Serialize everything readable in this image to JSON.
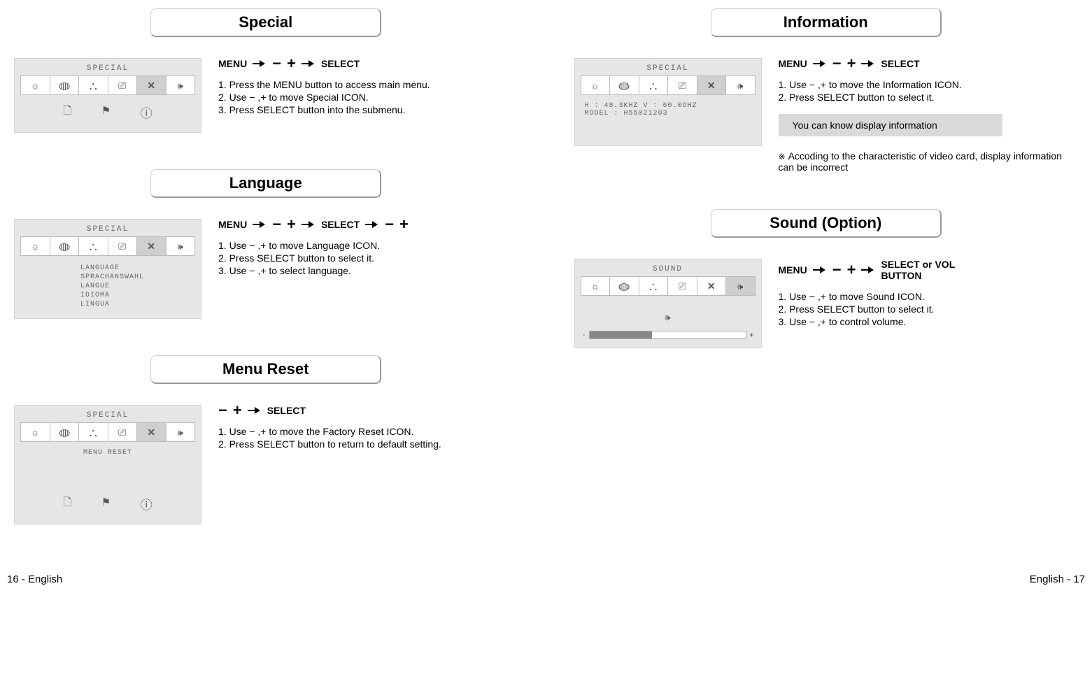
{
  "footer": {
    "left": "16 - English",
    "right": "English - 17"
  },
  "headings": {
    "special": "Special",
    "language": "Language",
    "menu_reset": "Menu Reset",
    "information": "Information",
    "sound": "Sound (Option)"
  },
  "buttons": {
    "menu": "MENU",
    "select": "SELECT",
    "select_or_vol": "SELECT or VOL BUTTON"
  },
  "osd": {
    "special_title": "SPECIAL",
    "sound_title": "SOUND",
    "lang_items": [
      "LANGUAGE",
      "SPRACHANSWAHL",
      "LANGUE",
      "IDIOMA",
      "LINGUA"
    ],
    "menu_reset_label": "MENU RESET",
    "info_line1": "H : 48.3KHZ  V : 60.0OHZ",
    "info_line2": "MODEL : H55021203"
  },
  "steps": {
    "special": [
      "1. Press the MENU button to access main menu.",
      "2. Use − ,+ to move Special ICON.",
      "3. Press SELECT button into the submenu."
    ],
    "language": [
      "1. Use − ,+ to move Language ICON.",
      "2. Press SELECT button to select it.",
      "3. Use − ,+ to select language."
    ],
    "menu_reset": [
      "1. Use − ,+ to move the Factory Reset ICON.",
      "2. Press SELECT button to return to default setting."
    ],
    "information": [
      "1. Use − ,+ to move the Information ICON.",
      "2. Press SELECT button to select it."
    ],
    "sound": [
      "1. Use − ,+ to move Sound ICON.",
      "2. Press SELECT button to select it.",
      "3. Use − ,+ to control volume."
    ]
  },
  "info_note": "You can know display information",
  "info_footnote": "Accoding to the characteristic of video card, display information can be incorrect"
}
